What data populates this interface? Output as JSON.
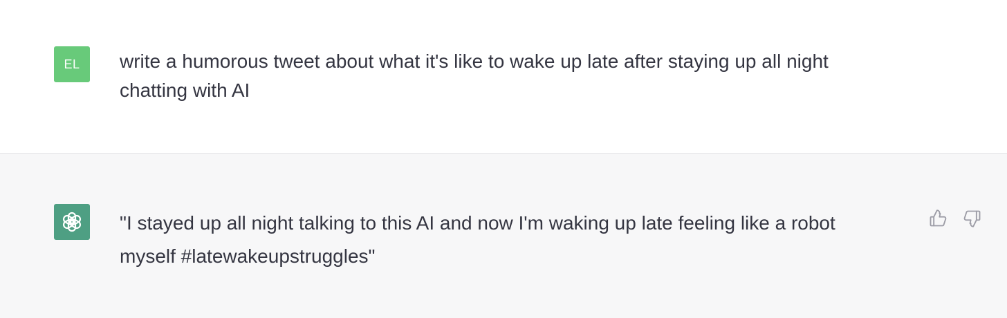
{
  "user_message": {
    "avatar_initials": "EL",
    "avatar_color": "#68ca7a",
    "text": "write a humorous tweet about what it's like to wake up late after staying up all night chatting with AI"
  },
  "assistant_message": {
    "avatar_icon": "openai-logo-icon",
    "avatar_color": "#4e9f83",
    "text": "\"I stayed up all night talking to this AI and now I'm waking up late feeling like a robot myself #latewakeupstruggles\""
  },
  "feedback": {
    "thumbs_up_icon": "thumbs-up-icon",
    "thumbs_down_icon": "thumbs-down-icon",
    "icon_color": "#9c9ca6"
  }
}
